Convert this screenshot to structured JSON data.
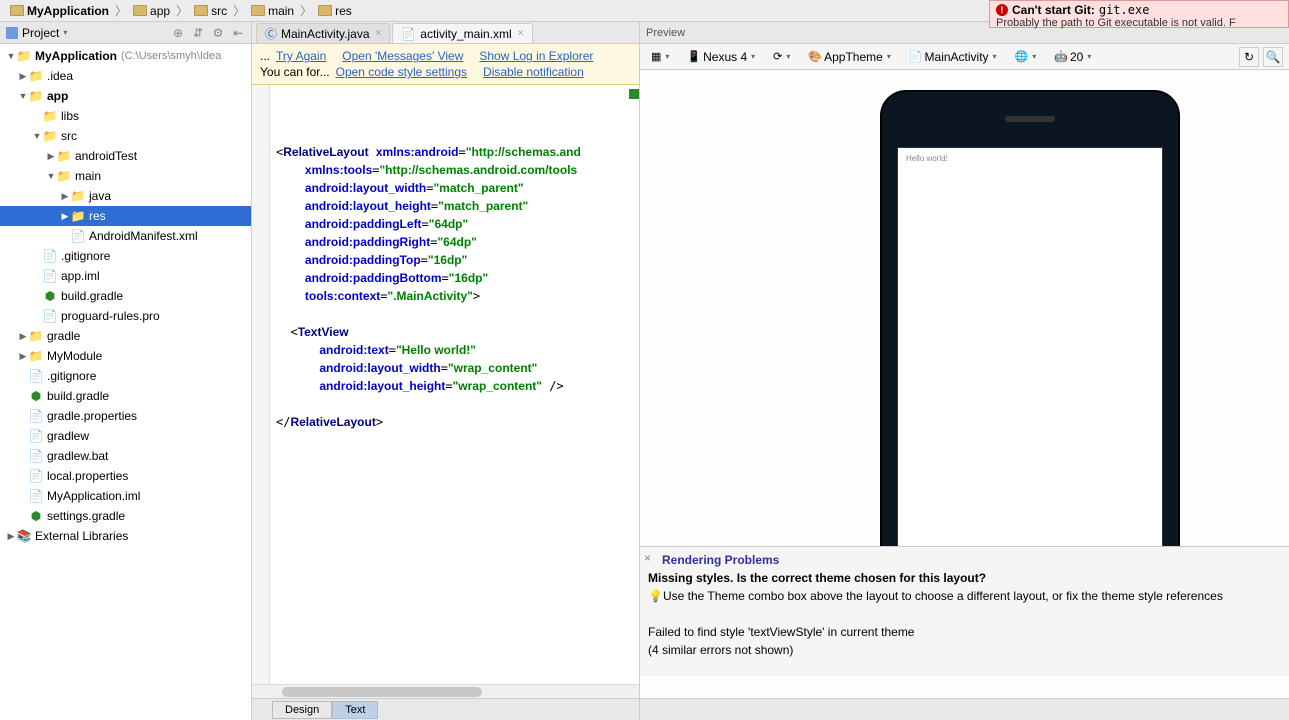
{
  "breadcrumb": [
    {
      "label": "MyApplication",
      "bold": true
    },
    {
      "label": "app"
    },
    {
      "label": "src"
    },
    {
      "label": "main"
    },
    {
      "label": "res"
    }
  ],
  "git_error": {
    "title": "Can't start Git:",
    "code": "git.exe",
    "sub": "Probably the path to Git executable is not valid. F"
  },
  "project_tool": {
    "label": "Project"
  },
  "tree": [
    {
      "label": "MyApplication",
      "muted": "(C:\\Users\\smyh\\Idea",
      "indent": 0,
      "arrow": "▼",
      "icon": "project",
      "bold": true
    },
    {
      "label": ".idea",
      "indent": 1,
      "arrow": "▶",
      "icon": "folder"
    },
    {
      "label": "app",
      "indent": 1,
      "arrow": "▼",
      "icon": "module",
      "bold": true
    },
    {
      "label": "libs",
      "indent": 2,
      "arrow": "",
      "icon": "folder"
    },
    {
      "label": "src",
      "indent": 2,
      "arrow": "▼",
      "icon": "folder"
    },
    {
      "label": "androidTest",
      "indent": 3,
      "arrow": "▶",
      "icon": "folder"
    },
    {
      "label": "main",
      "indent": 3,
      "arrow": "▼",
      "icon": "folder"
    },
    {
      "label": "java",
      "indent": 4,
      "arrow": "▶",
      "icon": "src-folder"
    },
    {
      "label": "res",
      "indent": 4,
      "arrow": "▶",
      "icon": "res-folder",
      "selected": true
    },
    {
      "label": "AndroidManifest.xml",
      "indent": 4,
      "arrow": "",
      "icon": "xml"
    },
    {
      "label": ".gitignore",
      "indent": 2,
      "arrow": "",
      "icon": "file"
    },
    {
      "label": "app.iml",
      "indent": 2,
      "arrow": "",
      "icon": "iml"
    },
    {
      "label": "build.gradle",
      "indent": 2,
      "arrow": "",
      "icon": "gradle"
    },
    {
      "label": "proguard-rules.pro",
      "indent": 2,
      "arrow": "",
      "icon": "file"
    },
    {
      "label": "gradle",
      "indent": 1,
      "arrow": "▶",
      "icon": "folder"
    },
    {
      "label": "MyModule",
      "indent": 1,
      "arrow": "▶",
      "icon": "module"
    },
    {
      "label": ".gitignore",
      "indent": 1,
      "arrow": "",
      "icon": "file"
    },
    {
      "label": "build.gradle",
      "indent": 1,
      "arrow": "",
      "icon": "gradle"
    },
    {
      "label": "gradle.properties",
      "indent": 1,
      "arrow": "",
      "icon": "prop"
    },
    {
      "label": "gradlew",
      "indent": 1,
      "arrow": "",
      "icon": "file"
    },
    {
      "label": "gradlew.bat",
      "indent": 1,
      "arrow": "",
      "icon": "file"
    },
    {
      "label": "local.properties",
      "indent": 1,
      "arrow": "",
      "icon": "prop"
    },
    {
      "label": "MyApplication.iml",
      "indent": 1,
      "arrow": "",
      "icon": "iml"
    },
    {
      "label": "settings.gradle",
      "indent": 1,
      "arrow": "",
      "icon": "gradle"
    },
    {
      "label": "External Libraries",
      "indent": 0,
      "arrow": "▶",
      "icon": "lib"
    }
  ],
  "tabs": [
    {
      "label": "MainActivity.java",
      "icon": "C",
      "active": false
    },
    {
      "label": "activity_main.xml",
      "icon": "xml",
      "active": true
    }
  ],
  "hints": {
    "row1_prefix": "...",
    "try_again": "Try Again",
    "open_messages": "Open 'Messages' View",
    "show_log": "Show Log in Explorer",
    "row2_prefix": "You can for...",
    "open_style": "Open code style settings",
    "disable": "Disable notification"
  },
  "code": {
    "l1_tag": "RelativeLayout",
    "l1_a1": "xmlns:android",
    "l1_v1": "\"http://schemas.and",
    "l2_a": "xmlns:tools",
    "l2_v": "\"http://schemas.android.com/tools",
    "l3_a": "android:layout_width",
    "l3_v": "\"match_parent\"",
    "l4_a": "android:layout_height",
    "l4_v": "\"match_parent\"",
    "l5_a": "android:paddingLeft",
    "l5_v": "\"64dp\"",
    "l6_a": "android:paddingRight",
    "l6_v": "\"64dp\"",
    "l7_a": "android:paddingTop",
    "l7_v": "\"16dp\"",
    "l8_a": "android:paddingBottom",
    "l8_v": "\"16dp\"",
    "l9_a": "tools:context",
    "l9_v": "\".MainActivity\"",
    "l11_tag": "TextView",
    "l12_a": "android:text",
    "l12_v": "\"Hello world!\"",
    "l13_a": "android:layout_width",
    "l13_v": "\"wrap_content\"",
    "l14_a": "android:layout_height",
    "l14_v": "\"wrap_content\"",
    "l16_tag": "RelativeLayout"
  },
  "bottom_tabs": {
    "design": "Design",
    "text": "Text"
  },
  "preview": {
    "label": "Preview",
    "device": "Nexus 4",
    "theme": "AppTheme",
    "activity": "MainActivity",
    "api": "20",
    "phone_text": "Hello world!"
  },
  "render": {
    "title": "Rendering Problems",
    "line1": "Missing styles. Is the correct theme chosen for this layout?",
    "line2": "Use the Theme combo box above the layout to choose a different layout, or fix the theme style references",
    "line3": "Failed to find style 'textViewStyle' in current theme",
    "line4": "(4 similar errors not shown)"
  }
}
